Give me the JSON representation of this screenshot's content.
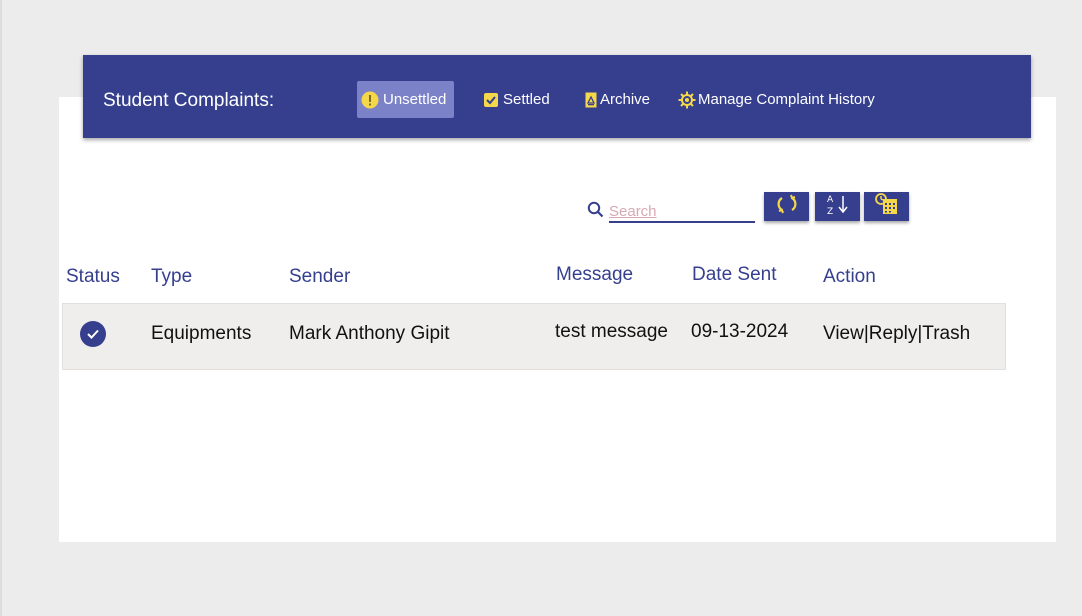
{
  "header": {
    "title": "Student Complaints:",
    "tabs": [
      {
        "label": "Unsettled",
        "icon": "warning-icon",
        "active": true
      },
      {
        "label": "Settled",
        "icon": "checkbox-icon",
        "active": false
      },
      {
        "label": "Archive",
        "icon": "archive-icon",
        "active": false
      },
      {
        "label": "Manage Complaint History",
        "icon": "gear-icon",
        "active": false
      }
    ]
  },
  "toolbar": {
    "search_placeholder": "Search",
    "buttons": [
      {
        "icon": "refresh-icon"
      },
      {
        "icon": "sort-az-icon"
      },
      {
        "icon": "calendar-filter-icon"
      }
    ]
  },
  "table": {
    "columns": [
      "Status",
      "Type",
      "Sender",
      "Message",
      "Date Sent",
      "Action"
    ],
    "rows": [
      {
        "status": "settled-check",
        "type": "Equipments",
        "sender": "Mark Anthony Gipit",
        "message": "test message",
        "date_sent": "09-13-2024",
        "actions": {
          "view": "View",
          "sep1": "|",
          "reply": "Reply",
          "sep2": "|",
          "trash": "Trash"
        }
      }
    ]
  },
  "colors": {
    "primary": "#353f8e",
    "accent_yellow": "#f5d84a",
    "active_tab": "#7b82c7",
    "row_bg": "#f0eeed",
    "background": "#ececec"
  }
}
